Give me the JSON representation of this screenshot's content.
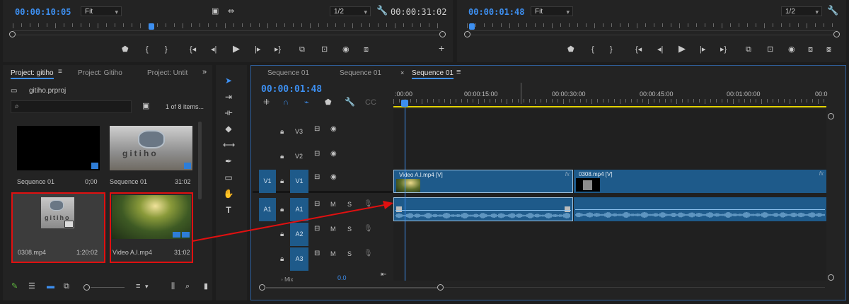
{
  "colors": {
    "accent": "#3d8ff0",
    "clip": "#1e5a8a",
    "highlight": "#e01010",
    "workarea": "#e3d300"
  },
  "source_monitor": {
    "timecode": "00:00:10:05",
    "fit": "Fit",
    "resolution": "1/2",
    "duration": "00:00:31:02"
  },
  "program_monitor": {
    "timecode": "00:00:01:48",
    "fit": "Fit",
    "resolution": "1/2"
  },
  "project": {
    "tabs": [
      "Project: gitiho",
      "Project: Gitiho",
      "Project: Untit"
    ],
    "file": "gitiho.prproj",
    "items_count": "1 of 8 items...",
    "items": [
      {
        "name": "Sequence 01",
        "duration": "0;00"
      },
      {
        "name": "Sequence 01",
        "duration": "31:02"
      },
      {
        "name": "0308.mp4",
        "duration": "1:20:02"
      },
      {
        "name": "Video A.I.mp4",
        "duration": "31:02"
      }
    ],
    "thumb_text": "gitiho"
  },
  "timeline": {
    "tabs": [
      "Sequence 01",
      "Sequence 01",
      "Sequence 01"
    ],
    "timecode": "00:00:01:48",
    "ruler_labels": [
      ":00:00",
      "00:00:15:00",
      "00:00:30:00",
      "00:00:45:00",
      "00:01:00:00",
      "00:0"
    ],
    "tracks": {
      "v3": "V3",
      "v2": "V2",
      "v1": "V1",
      "v1_src": "V1",
      "a1": "A1",
      "a1_src": "A1",
      "a2": "A2",
      "a3": "A3",
      "mute": "M",
      "solo": "S",
      "mix": "Mix",
      "mix_value": "0.0"
    },
    "clips": [
      {
        "label": "Video A.I.mp4 [V]",
        "fx": "fx"
      },
      {
        "label": "0308.mp4 [V]",
        "fx": "fx"
      }
    ]
  },
  "icons": [
    "marker-icon",
    "mark-in-icon",
    "mark-out-icon",
    "go-to-in-icon",
    "step-back-icon",
    "play-icon",
    "step-forward-icon",
    "go-to-out-icon",
    "insert-icon",
    "overwrite-icon",
    "export-frame-icon",
    "settings-wrench-icon",
    "add-button-icon",
    "selection-tool-icon",
    "hand-tool-icon",
    "type-tool-icon"
  ]
}
